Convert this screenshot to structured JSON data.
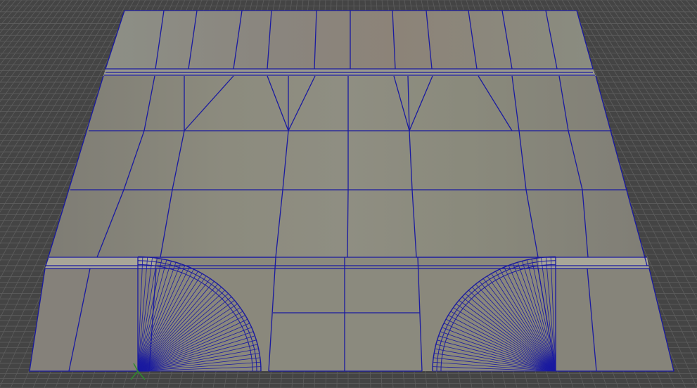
{
  "viewport": {
    "background_color": "#444444",
    "grid_color": "#5e5e5e",
    "mesh_surface_color": "#8a8a7c",
    "wire_color": "#1a1aa0",
    "highlight_edge_color": "#d8d8cc"
  },
  "scene": {
    "object": "road-intersection-mesh",
    "display_mode": "wireframe-on-shaded",
    "axis_gizmo": "world-axis-icon"
  }
}
